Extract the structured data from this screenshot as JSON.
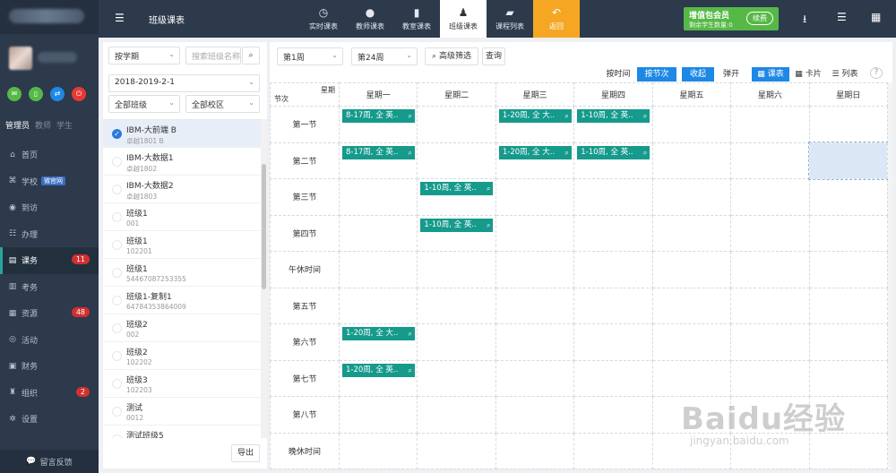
{
  "header": {
    "page_title": "班级课表",
    "tabs": [
      {
        "label": "实时课表",
        "icon": "clock-icon"
      },
      {
        "label": "教师课表",
        "icon": "teacher-icon"
      },
      {
        "label": "教室课表",
        "icon": "classroom-icon"
      },
      {
        "label": "班级课表",
        "icon": "group-icon",
        "active": true
      },
      {
        "label": "课程列表",
        "icon": "book-icon"
      },
      {
        "label": "返回",
        "icon": "back-arrow-icon"
      }
    ],
    "member": {
      "title": "增值包会员",
      "subtitle": "剩余学生数量:0",
      "renew": "续费"
    }
  },
  "sidebar": {
    "roles": [
      "管理员",
      "教师",
      "学生"
    ],
    "nav": [
      {
        "label": "首页",
        "icon": "home-icon"
      },
      {
        "label": "学校",
        "icon": "school-icon",
        "tag": "微官网"
      },
      {
        "label": "到访",
        "icon": "eye-icon"
      },
      {
        "label": "办理",
        "icon": "users-icon"
      },
      {
        "label": "课务",
        "icon": "book-icon",
        "badge": "11",
        "active": true
      },
      {
        "label": "考务",
        "icon": "exam-icon"
      },
      {
        "label": "资源",
        "icon": "resource-icon",
        "badge": "48"
      },
      {
        "label": "活动",
        "icon": "activity-icon"
      },
      {
        "label": "财务",
        "icon": "finance-icon"
      },
      {
        "label": "组织",
        "icon": "org-icon",
        "badge": "2"
      },
      {
        "label": "设置",
        "icon": "gear-icon"
      }
    ],
    "feedback": "留言反馈"
  },
  "panel": {
    "filter_mode": "按学期",
    "search_placeholder": "搜索班级名称",
    "term": "2018-2019-2-1",
    "class_filter": "全部班级",
    "campus_filter": "全部校区",
    "classes": [
      {
        "name": "IBM-大前端 B",
        "code": "卓越1801 B"
      },
      {
        "name": "IBM-大数据1",
        "code": "卓越1802"
      },
      {
        "name": "IBM-大数据2",
        "code": "卓越1803"
      },
      {
        "name": "班级1",
        "code": "001"
      },
      {
        "name": "班级1",
        "code": "102201"
      },
      {
        "name": "班级1",
        "code": "54467087253355"
      },
      {
        "name": "班级1-复制1",
        "code": "64784353864009"
      },
      {
        "name": "班级2",
        "code": "002"
      },
      {
        "name": "班级2",
        "code": "102202"
      },
      {
        "name": "班级3",
        "code": "102203"
      },
      {
        "name": "测试",
        "code": "0012"
      },
      {
        "name": "测试班级5",
        "code": ""
      }
    ],
    "export": "导出"
  },
  "toolbar": {
    "week_start": "第1周",
    "week_end": "第24周",
    "advanced": "高级筛选",
    "query": "查询",
    "by_time": "按时间",
    "by_period": "按节次",
    "collapse": "收起",
    "expand": "弹开",
    "view_timetable": "课表",
    "view_card": "卡片",
    "view_list": "列表"
  },
  "timetable": {
    "corner_top": "星期",
    "corner_bottom": "节次",
    "days": [
      "星期一",
      "星期二",
      "星期三",
      "星期四",
      "星期五",
      "星期六",
      "星期日"
    ],
    "periods": [
      "第一节",
      "第二节",
      "第三节",
      "第四节",
      "午休时间",
      "第五节",
      "第六节",
      "第七节",
      "第八节",
      "晚休时间"
    ],
    "lessons": {
      "p1_mon": "8-17周, 全 英..",
      "p1_wed": "1-20周, 全 大..",
      "p1_thu": "1-10周, 全 英..",
      "p2_mon": "8-17周, 全 英..",
      "p2_wed": "1-20周, 全 大..",
      "p2_thu": "1-10周, 全 英..",
      "p3_tue": "1-10周, 全 英..",
      "p4_tue": "1-10周, 全 英..",
      "p6_mon": "1-20周, 全 大..",
      "p7_mon": "1-20周, 全 英.."
    }
  },
  "watermark": {
    "brand": "Baidu经验",
    "url": "jingyan.baidu.com"
  }
}
